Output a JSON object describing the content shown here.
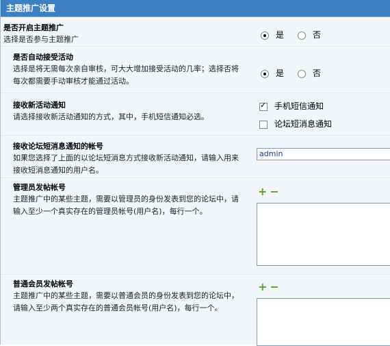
{
  "header": {
    "title": "主题推广设置"
  },
  "rows": [
    {
      "title": "是否开启主题推广",
      "desc": "选择是否参与主题推广",
      "yes": "是",
      "no": "否",
      "selected": "yes"
    },
    {
      "title": "是否自动接受活动",
      "desc": "选择是将无需每次亲自审核，可大大增加接受活动的几率；选择否将每次都需要手动审核才能通过活动。",
      "yes": "是",
      "no": "否",
      "selected": "yes"
    },
    {
      "title": "接收新活动通知",
      "desc": "请选择接收新活动通知的方式，其中，手机短信通知必选。",
      "options": [
        {
          "label": "手机短信通知",
          "checked": true
        },
        {
          "label": "论坛短消息通知",
          "checked": false
        }
      ]
    },
    {
      "title": "接收论坛短消息通知的帐号",
      "desc": "如果您选择了上面的以论坛短消息方式接收新活动通知，请输入用来接收短消息通知的用户名。",
      "value": "admin"
    },
    {
      "title": "管理员发帖帐号",
      "desc": "主题推广中的某些主题，需要以管理员的身份发表到您的论坛中，请输入至少一个真实存在的管理员帐号(用户名)，每行一个。",
      "plus": "+",
      "minus": "−"
    },
    {
      "title": "普通会员发帖帐号",
      "desc": "主题推广中的某些主题，需要以普通会员的身份发表到您的论坛中，请输入至少两个真实存在的普通会员帐号(用户名)，每行一个。",
      "plus": "+",
      "minus": "−"
    }
  ]
}
